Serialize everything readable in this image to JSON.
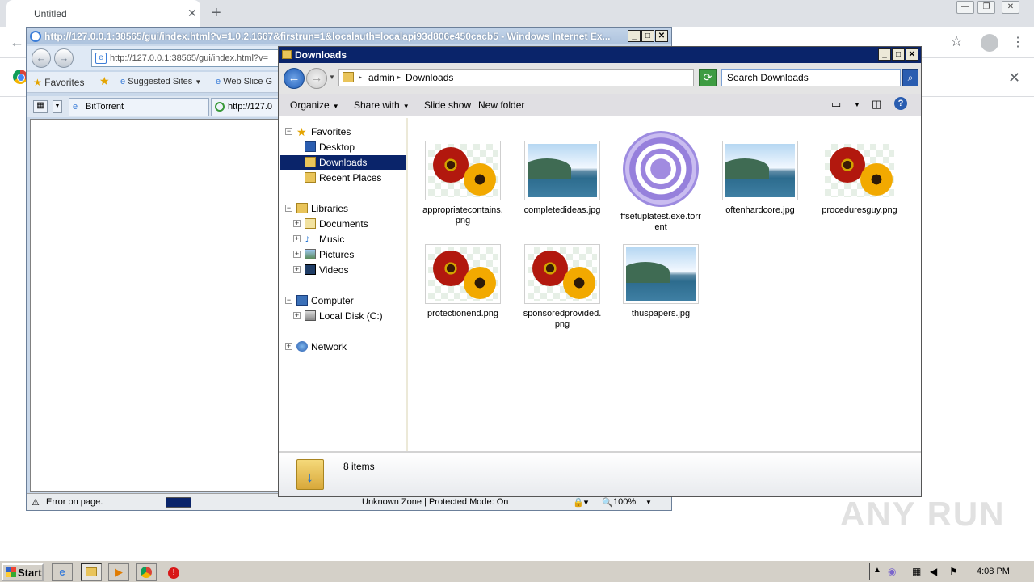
{
  "chrome": {
    "tab_title": "Untitled",
    "tab_close": "✕",
    "new_tab": "+"
  },
  "ie": {
    "title": "http://127.0.0.1:38565/gui/index.html?v=1.0.2.1667&firstrun=1&localauth=localapi93d806e450cacb5 - Windows Internet Ex...",
    "address": "http://127.0.0.1:38565/gui/index.html?v=",
    "favorites_label": "Favorites",
    "suggested_sites": "Suggested Sites",
    "web_slice": "Web Slice G",
    "tab_bittorrent": "BitTorrent",
    "tab_url": "http://127.0",
    "status_error": "Error on page.",
    "status_zone": "Unknown Zone | Protected Mode: On",
    "status_zoom": "100%"
  },
  "explorer": {
    "title": "Downloads",
    "breadcrumb": [
      "admin",
      "Downloads"
    ],
    "search_placeholder": "Search Downloads",
    "commands": {
      "organize": "Organize",
      "share_with": "Share with",
      "slide_show": "Slide show",
      "new_folder": "New folder"
    },
    "nav_tree": {
      "favorites": "Favorites",
      "desktop": "Desktop",
      "downloads": "Downloads",
      "recent_places": "Recent Places",
      "libraries": "Libraries",
      "documents": "Documents",
      "music": "Music",
      "pictures": "Pictures",
      "videos": "Videos",
      "computer": "Computer",
      "local_disk": "Local Disk (C:)",
      "network": "Network"
    },
    "files": [
      {
        "name": "appropriatecontains.png",
        "kind": "flower"
      },
      {
        "name": "completedideas.jpg",
        "kind": "sea"
      },
      {
        "name": "ffsetuplatest.exe.torrent",
        "kind": "torrent"
      },
      {
        "name": "oftenhardcore.jpg",
        "kind": "sea"
      },
      {
        "name": "proceduresguy.png",
        "kind": "flower"
      },
      {
        "name": "protectionend.png",
        "kind": "flower"
      },
      {
        "name": "sponsoredprovided.png",
        "kind": "flower"
      },
      {
        "name": "thuspapers.jpg",
        "kind": "sea"
      }
    ],
    "item_count": "8 items"
  },
  "watermark": "ANY RUN",
  "taskbar": {
    "start_label": "Start",
    "clock": "4:08 PM"
  }
}
